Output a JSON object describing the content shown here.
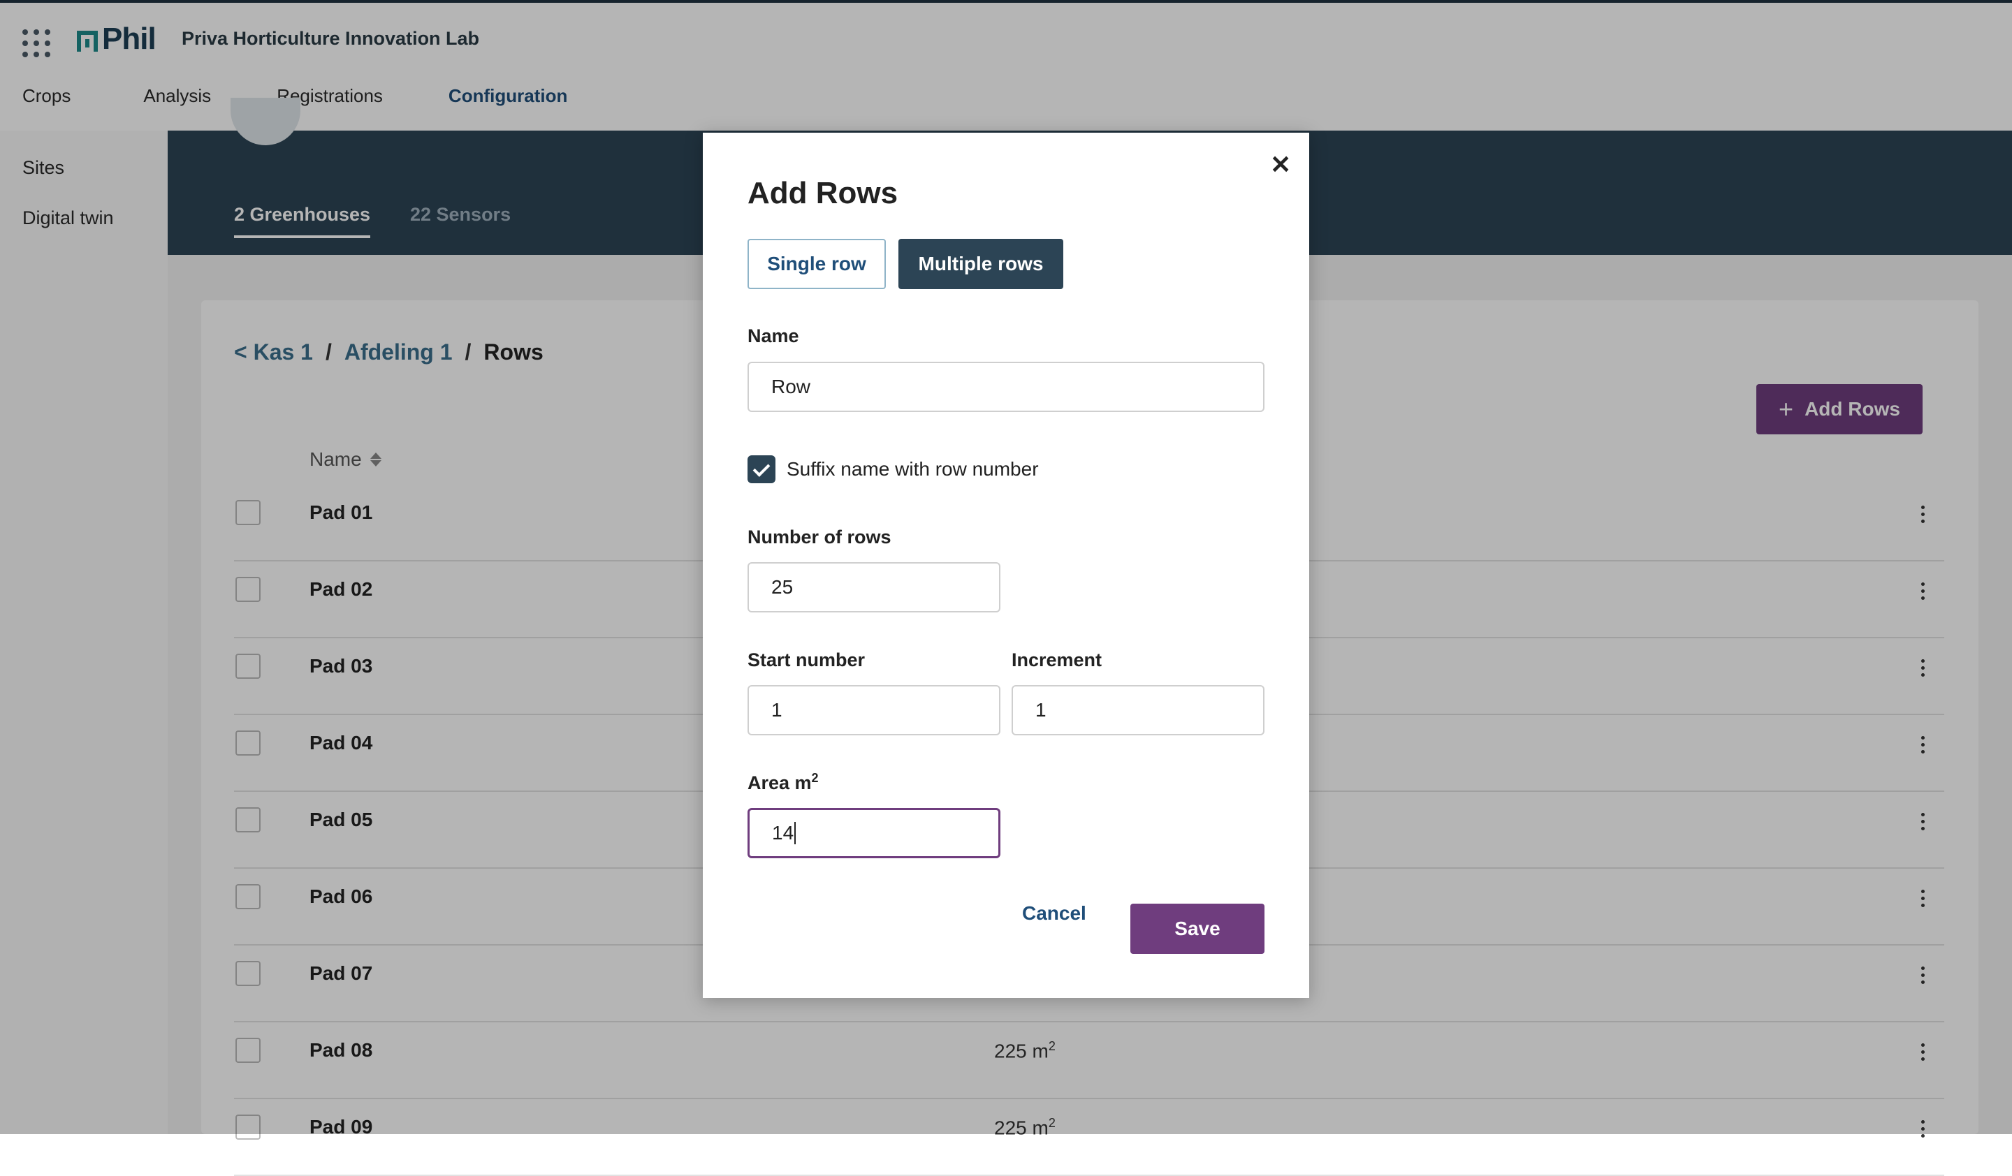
{
  "app": {
    "logo_text": "Phil",
    "org_name": "Priva Horticulture Innovation Lab"
  },
  "main_nav": [
    {
      "label": "Crops"
    },
    {
      "label": "Analysis"
    },
    {
      "label": "Registrations"
    },
    {
      "label": "Configuration",
      "active": true
    }
  ],
  "side_nav": [
    {
      "label": "Sites"
    },
    {
      "label": "Digital twin"
    }
  ],
  "tabs": [
    {
      "label": "2 Greenhouses",
      "active": true
    },
    {
      "label": "22 Sensors"
    }
  ],
  "breadcrumb": {
    "back": "< Kas 1",
    "separator": "/",
    "middle": "Afdeling 1",
    "current": "Rows"
  },
  "toolbar": {
    "add_rows_label": "Add Rows",
    "add_icon": "plus-icon"
  },
  "table": {
    "column_name": "Name",
    "area_unit": "m",
    "area_exponent": "2",
    "rows": [
      {
        "name": "Pad 01",
        "area": ""
      },
      {
        "name": "Pad 02",
        "area": ""
      },
      {
        "name": "Pad 03",
        "area": ""
      },
      {
        "name": "Pad 04",
        "area": ""
      },
      {
        "name": "Pad 05",
        "area": ""
      },
      {
        "name": "Pad 06",
        "area": ""
      },
      {
        "name": "Pad 07",
        "area": ""
      },
      {
        "name": "Pad 08",
        "area": "225"
      },
      {
        "name": "Pad 09",
        "area": "225"
      }
    ]
  },
  "modal": {
    "title": "Add Rows",
    "close_icon": "close-icon",
    "tab_single": "Single row",
    "tab_multiple": "Multiple rows",
    "name_label": "Name",
    "name_value": "Row",
    "suffix_label": "Suffix name with row number",
    "suffix_checked": true,
    "count_label": "Number of rows",
    "count_value": "25",
    "start_label": "Start number",
    "start_value": "1",
    "increment_label": "Increment",
    "increment_value": "1",
    "area_label": "Area m",
    "area_exponent": "2",
    "area_value": "14",
    "cancel_label": "Cancel",
    "save_label": "Save"
  },
  "colors": {
    "header_band": "#2c4455",
    "primary_purple": "#6f3d7e",
    "link_blue": "#1f4e79",
    "overlay": "rgba(0,0,0,0.29)"
  }
}
